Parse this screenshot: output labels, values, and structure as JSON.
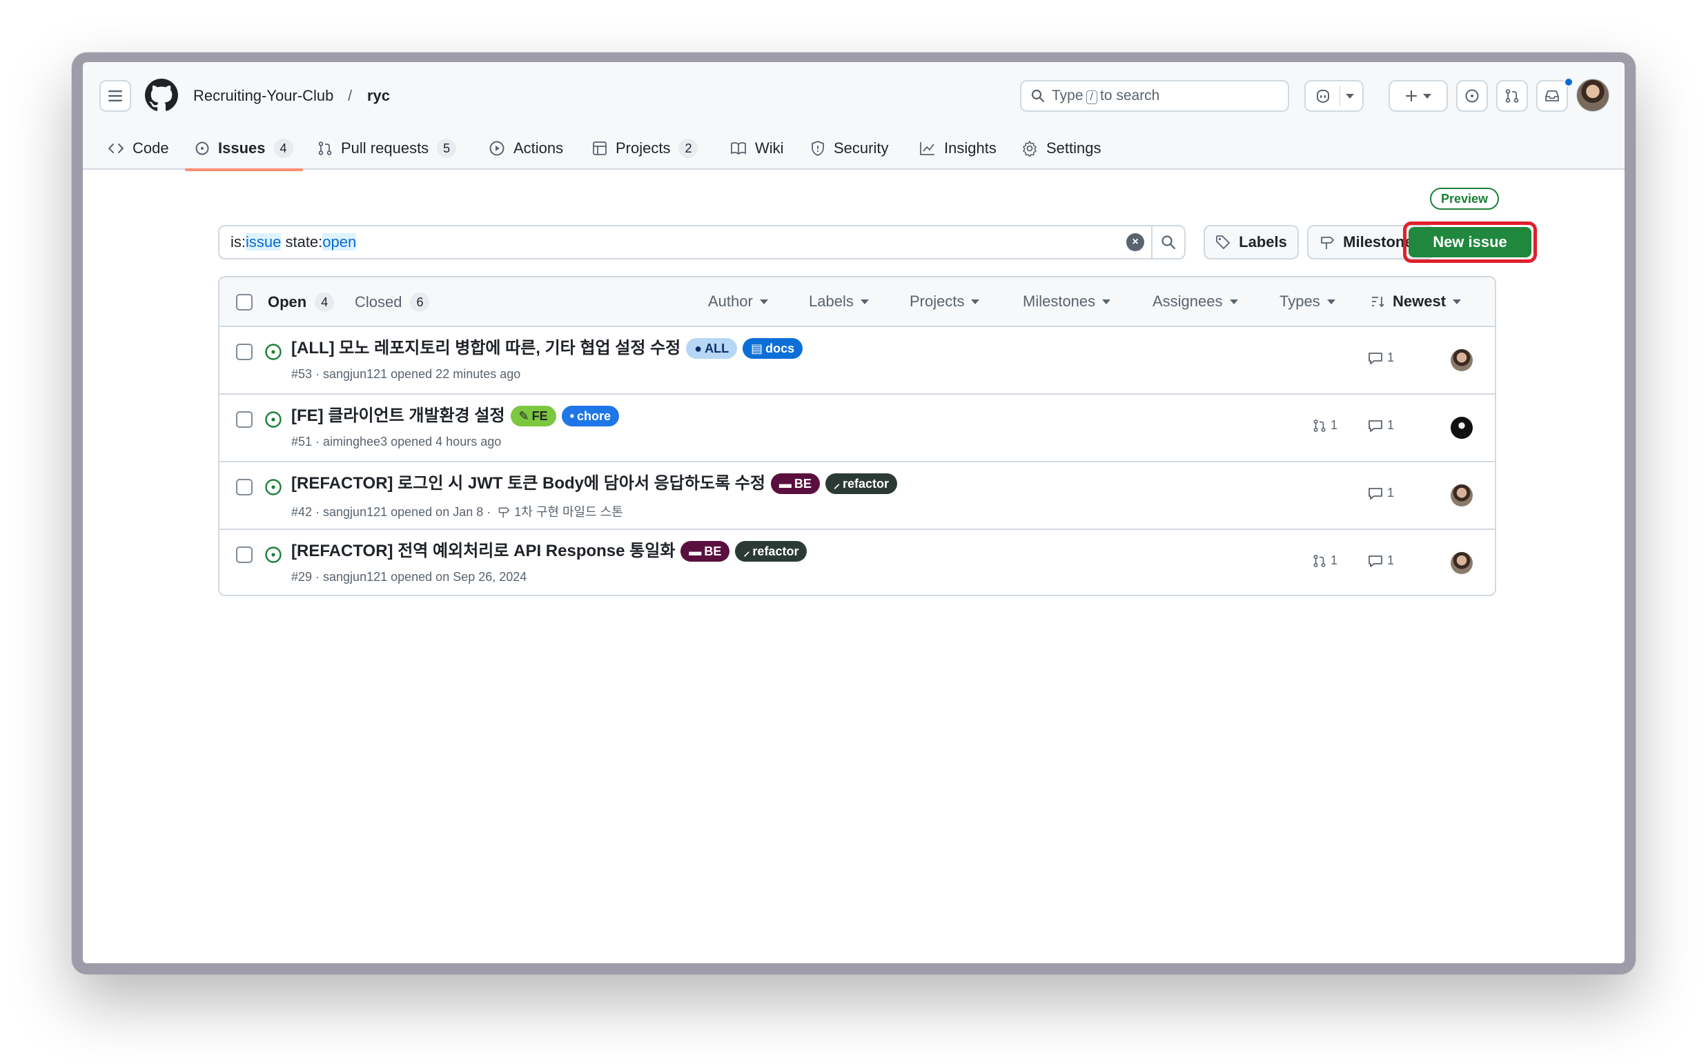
{
  "repo": {
    "org": "Recruiting-Your-Club",
    "separator": "/",
    "name": "ryc"
  },
  "search": {
    "text_before": "Type",
    "kbd": "/",
    "text_after": "to search"
  },
  "tabs": [
    {
      "label": "Code",
      "icon": "code-icon"
    },
    {
      "label": "Issues",
      "count": "4",
      "icon": "issue-opened-icon"
    },
    {
      "label": "Pull requests",
      "count": "5",
      "icon": "git-pull-request-icon"
    },
    {
      "label": "Actions",
      "icon": "play-icon"
    },
    {
      "label": "Projects",
      "count": "2",
      "icon": "table-icon"
    },
    {
      "label": "Wiki",
      "icon": "book-icon"
    },
    {
      "label": "Security",
      "icon": "shield-icon"
    },
    {
      "label": "Insights",
      "icon": "graph-icon"
    },
    {
      "label": "Settings",
      "icon": "gear-icon"
    }
  ],
  "preview_badge": "Preview",
  "filter": {
    "prefix1": "is:",
    "kw1": "issue",
    "prefix2": " state:",
    "kw2": "open"
  },
  "buttons": {
    "labels": "Labels",
    "milestones": "Milestones",
    "new_issue": "New issue"
  },
  "list_header": {
    "open_label": "Open",
    "open_count": "4",
    "closed_label": "Closed",
    "closed_count": "6",
    "filters": [
      "Author",
      "Labels",
      "Projects",
      "Milestones",
      "Assignees",
      "Types"
    ],
    "sort": "Newest"
  },
  "issues": [
    {
      "title": "[ALL] 모노 레포지토리 병합에 따른, 기타 협업 설정 수정",
      "labels": [
        {
          "text": "ALL",
          "emoji": "●",
          "bg": "#b6d7f5",
          "fg": "#0a3069"
        },
        {
          "text": "docs",
          "emoji": "▤",
          "bg": "#0c6fd6",
          "fg": "#ffffff"
        }
      ],
      "meta": "#53 · sangjun121 opened 22 minutes ago",
      "milestone": "",
      "pr_count": "",
      "comment_count": "1"
    },
    {
      "title": "[FE] 클라이언트 개발환경 설정",
      "labels": [
        {
          "text": "FE",
          "emoji": "✎",
          "bg": "#7cc73f",
          "fg": "#1f2328"
        },
        {
          "text": "chore",
          "emoji": "•",
          "bg": "#1e76e8",
          "fg": "#ffffff"
        }
      ],
      "meta": "#51 · aiminghee3 opened 4 hours ago",
      "milestone": "",
      "pr_count": "1",
      "comment_count": "1"
    },
    {
      "title": "[REFACTOR] 로그인 시 JWT 토큰 Body에 담아서 응답하도록 수정",
      "labels": [
        {
          "text": "BE",
          "emoji": "▬",
          "bg": "#5a0f3f",
          "fg": "#ffffff"
        },
        {
          "text": "refactor",
          "emoji": "⸝",
          "bg": "#2b3a35",
          "fg": "#ffffff"
        }
      ],
      "meta": "#42 · sangjun121 opened on Jan 8 ·",
      "milestone": "1차 구현 마일드 스톤",
      "pr_count": "",
      "comment_count": "1"
    },
    {
      "title": "[REFACTOR] 전역 예외처리로 API Response 통일화",
      "labels": [
        {
          "text": "BE",
          "emoji": "▬",
          "bg": "#5a0f3f",
          "fg": "#ffffff"
        },
        {
          "text": "refactor",
          "emoji": "⸝",
          "bg": "#2b3a35",
          "fg": "#ffffff"
        }
      ],
      "meta": "#29 · sangjun121 opened on Sep 26, 2024",
      "milestone": "",
      "pr_count": "1",
      "comment_count": "1"
    }
  ],
  "colors": {
    "accent_green": "#1f883d",
    "open_green": "#1a7f37",
    "link_blue": "#0969da",
    "highlight_red": "#e0202a",
    "tab_underline": "#fd8c73"
  }
}
